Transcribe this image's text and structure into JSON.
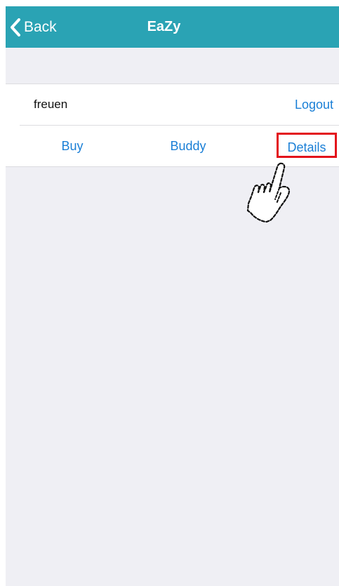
{
  "navbar": {
    "back_label": "Back",
    "title": "EaZy",
    "background_color": "#2aa3b4",
    "back_icon": "chevron-left-icon"
  },
  "account": {
    "username": "freuen",
    "logout_label": "Logout"
  },
  "actions": {
    "buy_label": "Buy",
    "buddy_label": "Buddy",
    "details_label": "Details",
    "link_color": "#1a7fd6",
    "highlight_color": "#e3131b"
  },
  "annotation": {
    "pointer_icon": "hand-pointer-icon"
  }
}
